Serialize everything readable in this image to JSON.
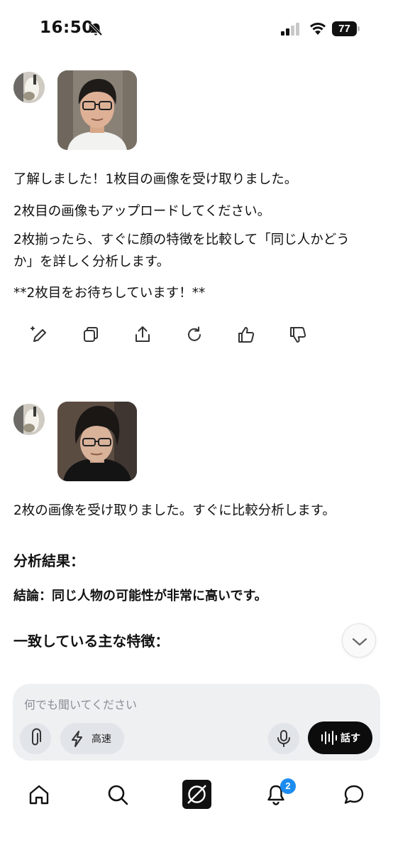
{
  "status_bar": {
    "time": "16:50",
    "battery": "77"
  },
  "chat": {
    "message1": {
      "lines": [
        "了解しました！1枚目の画像を受け取りました。",
        "2枚目の画像もアップロードしてください。",
        "2枚揃ったら、すぐに顔の特徴を比較して「同じ人かどう",
        "か」を詳しく分析します。",
        "**2枚目をお待ちしています！**"
      ]
    },
    "message2": {
      "intro": "2枚の画像を受け取りました。すぐに比較分析します。",
      "heading": "分析結果：",
      "conclusion": "結論：同じ人物の可能性が非常に高いです。",
      "subheading": "一致している主な特徴："
    },
    "action_icons": [
      "edit-sparkle-icon",
      "copy-icon",
      "share-icon",
      "regenerate-icon",
      "thumbs-up-icon",
      "thumbs-down-icon"
    ]
  },
  "composer": {
    "placeholder": "何でも聞いてください",
    "speed_label": "高速",
    "talk_label": "話す"
  },
  "tabbar": {
    "items": [
      "home-icon",
      "search-icon",
      "grok-icon",
      "notifications-icon",
      "messages-icon"
    ],
    "notification_count": "2"
  }
}
